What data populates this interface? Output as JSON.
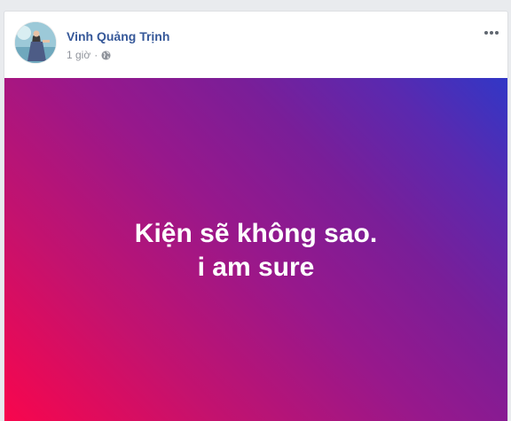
{
  "post": {
    "author": "Vinh Quảng Trịnh",
    "time": "1 giờ",
    "separator": "·",
    "privacy_icon": "globe-icon",
    "more_icon": "more-dots-icon",
    "status_lines": [
      "Kiện sẽ không sao.",
      "i am sure"
    ],
    "background_colors": [
      "#f8064d",
      "#97188c",
      "#3137c6"
    ]
  }
}
